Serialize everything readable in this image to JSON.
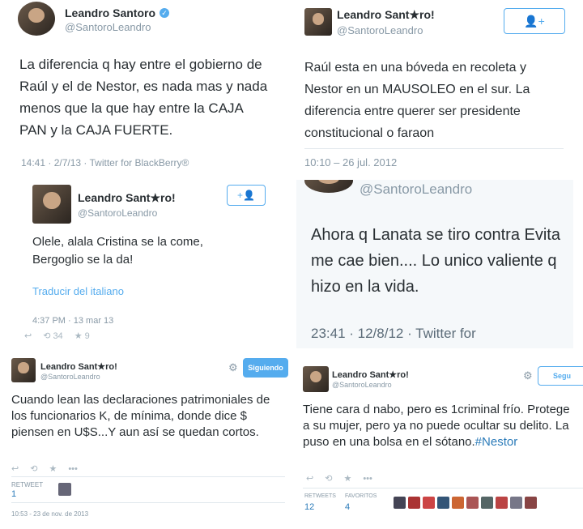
{
  "t1": {
    "name": "Leandro Santoro",
    "handle": "@SantoroLeandro",
    "text": "La diferencia q hay entre el gobierno de Raúl y el de Nestor, es nada mas y nada menos que la que hay entre la CAJA PAN y la CAJA FUERTE.",
    "meta": "14:41 · 2/7/13 · Twitter for BlackBerry®"
  },
  "t2": {
    "name": "Leandro Sant★ro!",
    "handle": "@SantoroLeandro",
    "text": "Raúl esta en una bóveda en recoleta y Nestor en un MAUSOLEO en el sur. La diferencia entre querer ser presidente constitucional o faraon",
    "meta": "10:10 – 26 jul. 2012"
  },
  "t3": {
    "name": "Leandro Sant★ro!",
    "handle": "@SantoroLeandro",
    "text": "Olele, alala Cristina se la come, Bergoglio se la da!",
    "translate": "Traducir del italiano",
    "meta": "4:37 PM · 13 mar 13",
    "retweets": "34",
    "favorites": "9"
  },
  "t4": {
    "handle": "@SantoroLeandro",
    "text": "Ahora q Lanata se tiro contra Evita me cae bien.... Lo unico valiente q hizo en la vida.",
    "meta": "23:41 · 12/8/12 · Twitter for"
  },
  "t5": {
    "name": "Leandro Sant★ro!",
    "handle": "@SantoroLeandro",
    "follow": "Siguiendo",
    "text": "Cuando lean las declaraciones patrimoniales de los funcionarios K, de mínima, donde dice $ piensen en U$S...Y aun así se quedan cortos.",
    "retweet_label": "RETWEET",
    "retweet_count": "1",
    "meta": "10:53 - 23 de nov. de 2013"
  },
  "t6": {
    "name": "Leandro Sant★ro!",
    "handle": "@SantoroLeandro",
    "follow": "Segu",
    "text_plain": "Tiene cara d nabo, pero es 1criminal frío. Protege a su mujer, pero ya no puede ocultar su delito. La puso en una bolsa en el sótano.",
    "hashtag": "#Nestor",
    "retweets_label": "RETWEETS",
    "favorites_label": "FAVORITOS",
    "retweets": "12",
    "favorites": "4"
  },
  "colors": {
    "accent": "#55acee",
    "text": "#292f33",
    "muted": "#8899a6",
    "link": "#2b7bb9"
  }
}
